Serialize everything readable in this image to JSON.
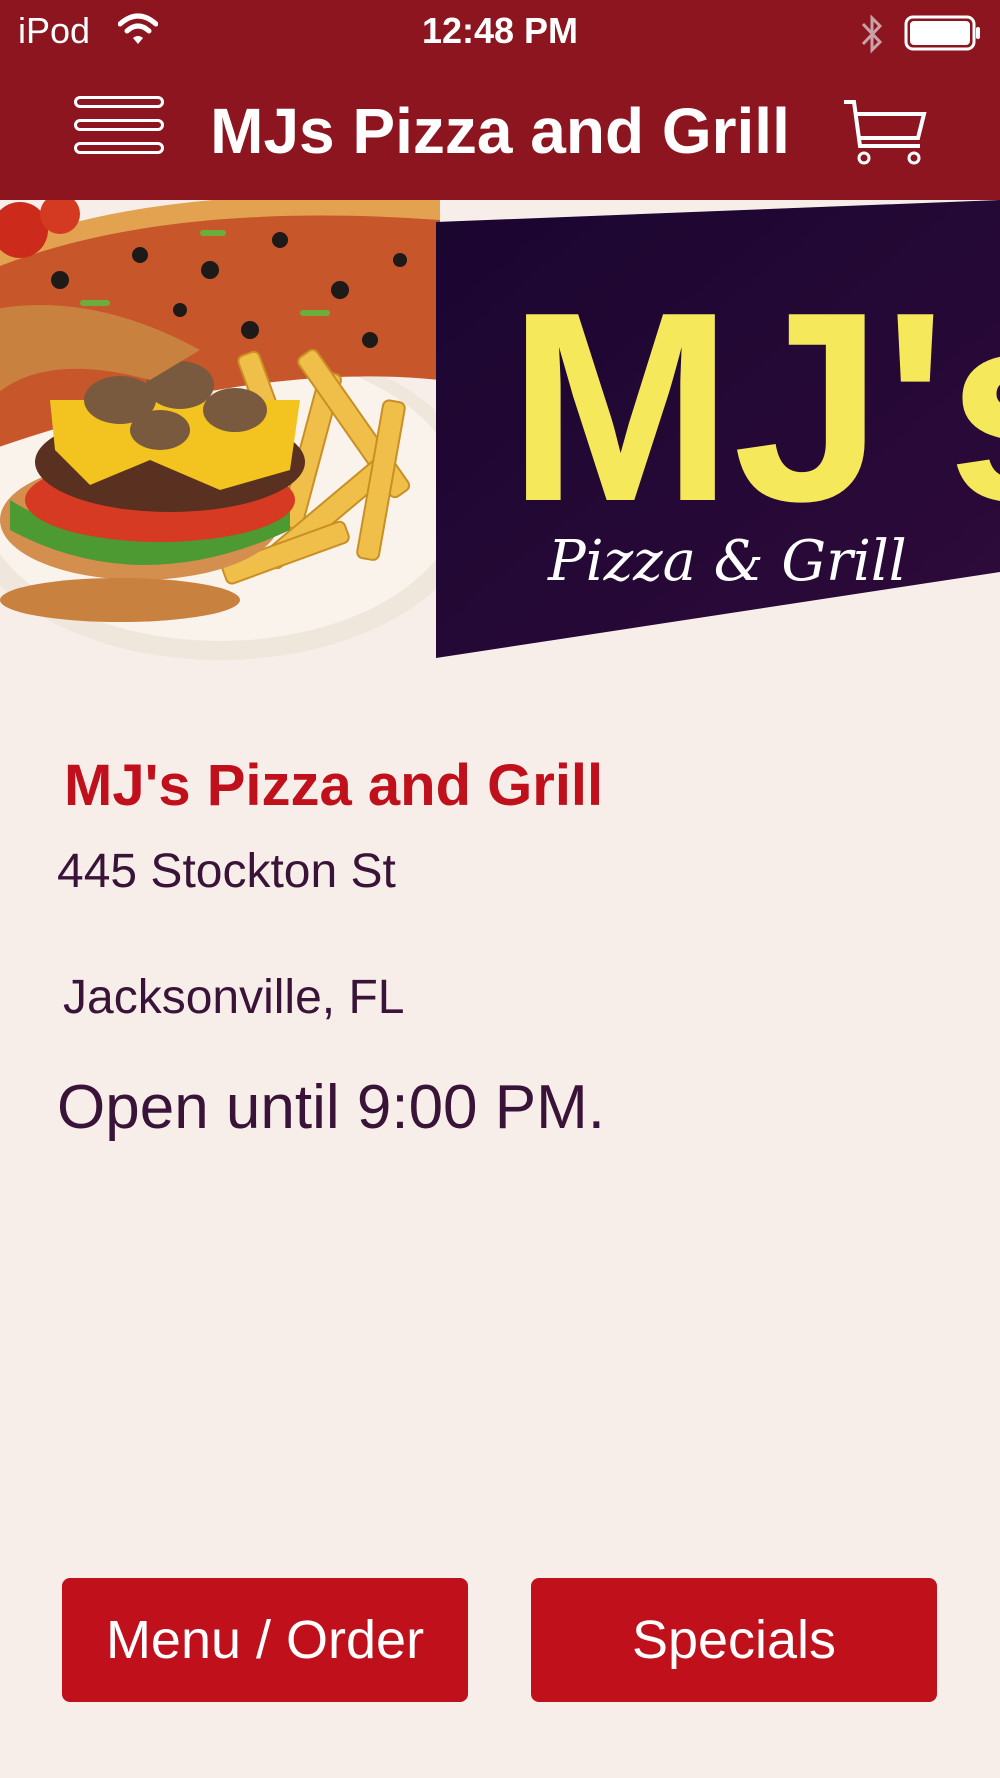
{
  "status_bar": {
    "carrier": "iPod",
    "time": "12:48 PM",
    "icons": [
      "wifi-icon",
      "bluetooth-icon",
      "battery-icon"
    ]
  },
  "nav_bar": {
    "title": "MJs Pizza and Grill",
    "left_icon": "hamburger-menu-icon",
    "right_icon": "shopping-cart-icon"
  },
  "hero": {
    "image": "pizza, burger and fries photo",
    "logo": {
      "main": "MJ's",
      "tagline": "Pizza & Grill"
    }
  },
  "restaurant": {
    "name": "MJ's Pizza and Grill",
    "address": "445 Stockton St",
    "city": "Jacksonville, FL",
    "hours": "Open until 9:00 PM."
  },
  "actions": {
    "menu_order": "Menu / Order",
    "specials": "Specials"
  },
  "colors": {
    "nav_background": "#8c1520",
    "accent_red": "#c0101c",
    "page_background": "#f7eeea",
    "text_dark": "#3a1438",
    "logo_purple": "#22083a",
    "logo_yellow": "#f5e85a"
  }
}
